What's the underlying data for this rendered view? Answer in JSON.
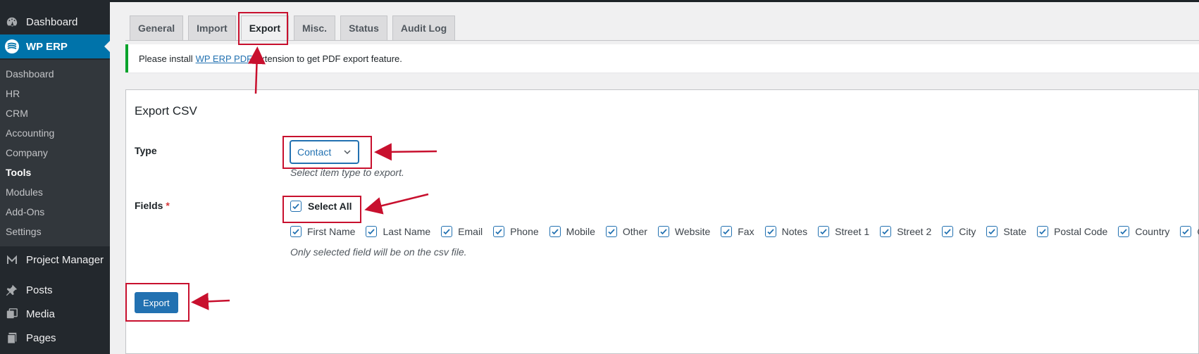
{
  "sidebar": {
    "top_items": [
      {
        "label": "Dashboard",
        "icon": "dashboard-icon"
      },
      {
        "label": "WP ERP",
        "icon": "wp-erp-icon"
      }
    ],
    "sub_items": [
      {
        "label": "Dashboard"
      },
      {
        "label": "HR"
      },
      {
        "label": "CRM"
      },
      {
        "label": "Accounting"
      },
      {
        "label": "Company"
      },
      {
        "label": "Tools"
      },
      {
        "label": "Modules"
      },
      {
        "label": "Add-Ons"
      },
      {
        "label": "Settings"
      }
    ],
    "current_sub": "Tools",
    "bottom_items": [
      {
        "label": "Project Manager",
        "icon": "project-manager-icon"
      },
      {
        "label": "Posts",
        "icon": "pin-icon"
      },
      {
        "label": "Media",
        "icon": "media-icon"
      },
      {
        "label": "Pages",
        "icon": "pages-icon"
      }
    ]
  },
  "tabs": [
    {
      "label": "General"
    },
    {
      "label": "Import"
    },
    {
      "label": "Export",
      "active": true
    },
    {
      "label": "Misc."
    },
    {
      "label": "Status"
    },
    {
      "label": "Audit Log"
    }
  ],
  "notice": {
    "before": "Please install",
    "link": "WP ERP PDF",
    "after": "extension to get PDF export feature."
  },
  "export": {
    "title": "Export CSV",
    "type_label": "Type",
    "type_value": "Contact",
    "type_desc": "Select item type to export.",
    "fields_label": "Fields",
    "required_mark": "*",
    "select_all": "Select All",
    "fields": [
      "First Name",
      "Last Name",
      "Email",
      "Phone",
      "Mobile",
      "Other",
      "Website",
      "Fax",
      "Notes",
      "Street 1",
      "Street 2",
      "City",
      "State",
      "Postal Code",
      "Country",
      "Currency"
    ],
    "fields_desc": "Only selected field will be on the csv file.",
    "button": "Export"
  },
  "colors": {
    "accent": "#2271b1",
    "sidebar": "#23282d",
    "highlight": "#c8102e",
    "notice_border": "#00a32a"
  }
}
